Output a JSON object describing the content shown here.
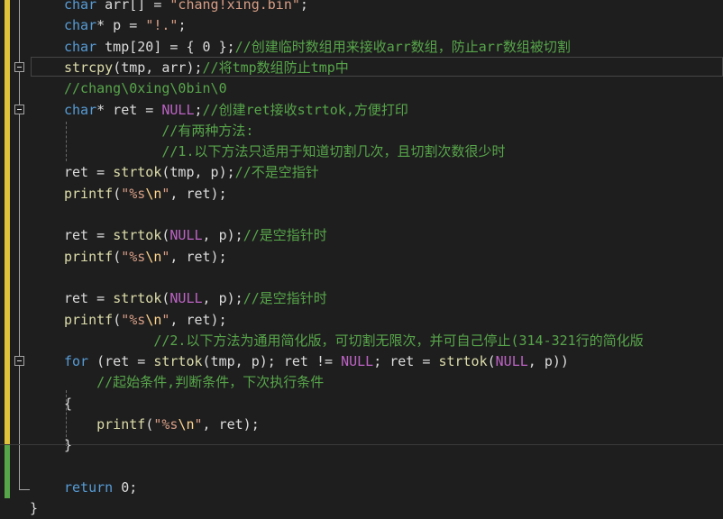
{
  "editor": {
    "lines": [
      {
        "fold": false,
        "tokens": [
          {
            "t": "char",
            "c": "kw"
          },
          {
            "t": " arr[] = ",
            "c": "id"
          },
          {
            "t": "\"chang!xing.bin\"",
            "c": "str"
          },
          {
            "t": ";",
            "c": "id"
          }
        ]
      },
      {
        "fold": false,
        "tokens": [
          {
            "t": "char",
            "c": "kw"
          },
          {
            "t": "* p = ",
            "c": "id"
          },
          {
            "t": "\"!.\"",
            "c": "str"
          },
          {
            "t": ";",
            "c": "id"
          }
        ]
      },
      {
        "fold": false,
        "tokens": [
          {
            "t": "char",
            "c": "kw"
          },
          {
            "t": " tmp[20] = { 0 };",
            "c": "id"
          },
          {
            "t": "//创建临时数组用来接收arr数组，防止arr数组被切割",
            "c": "cmt"
          }
        ]
      },
      {
        "fold": true,
        "tokens": [
          {
            "t": "strcpy",
            "c": "fn"
          },
          {
            "t": "(tmp, arr);",
            "c": "id"
          },
          {
            "t": "//将tmp数组防止tmp中",
            "c": "cmt"
          }
        ]
      },
      {
        "fold": false,
        "tokens": [
          {
            "t": "//chang\\0xing\\0bin\\0",
            "c": "cmt"
          }
        ]
      },
      {
        "fold": true,
        "tokens": [
          {
            "t": "char",
            "c": "kw"
          },
          {
            "t": "* ret = ",
            "c": "id"
          },
          {
            "t": "NULL",
            "c": "macro"
          },
          {
            "t": ";",
            "c": "id"
          },
          {
            "t": "//创建ret接收strtok,方便打印",
            "c": "cmt"
          }
        ]
      },
      {
        "fold": false,
        "tokens": [
          {
            "t": "            ",
            "c": "id"
          },
          {
            "t": "//有两种方法:",
            "c": "cmt"
          }
        ]
      },
      {
        "fold": false,
        "tokens": [
          {
            "t": "            ",
            "c": "id"
          },
          {
            "t": "//1.以下方法只适用于知道切割几次，且切割次数很少时",
            "c": "cmt"
          }
        ]
      },
      {
        "fold": false,
        "tokens": [
          {
            "t": "ret = ",
            "c": "id"
          },
          {
            "t": "strtok",
            "c": "fn"
          },
          {
            "t": "(tmp, p);",
            "c": "id"
          },
          {
            "t": "//不是空指针",
            "c": "cmt"
          }
        ]
      },
      {
        "fold": false,
        "tokens": [
          {
            "t": "printf",
            "c": "fn"
          },
          {
            "t": "(",
            "c": "id"
          },
          {
            "t": "\"%s",
            "c": "str"
          },
          {
            "t": "\\n",
            "c": "esc"
          },
          {
            "t": "\"",
            "c": "str"
          },
          {
            "t": ", ret);",
            "c": "id"
          }
        ]
      },
      {
        "fold": false,
        "tokens": []
      },
      {
        "fold": false,
        "tokens": [
          {
            "t": "ret = ",
            "c": "id"
          },
          {
            "t": "strtok",
            "c": "fn"
          },
          {
            "t": "(",
            "c": "id"
          },
          {
            "t": "NULL",
            "c": "macro"
          },
          {
            "t": ", p);",
            "c": "id"
          },
          {
            "t": "//是空指针时",
            "c": "cmt"
          }
        ]
      },
      {
        "fold": false,
        "tokens": [
          {
            "t": "printf",
            "c": "fn"
          },
          {
            "t": "(",
            "c": "id"
          },
          {
            "t": "\"%s",
            "c": "str"
          },
          {
            "t": "\\n",
            "c": "esc"
          },
          {
            "t": "\"",
            "c": "str"
          },
          {
            "t": ", ret);",
            "c": "id"
          }
        ]
      },
      {
        "fold": false,
        "tokens": []
      },
      {
        "fold": false,
        "tokens": [
          {
            "t": "ret = ",
            "c": "id"
          },
          {
            "t": "strtok",
            "c": "fn"
          },
          {
            "t": "(",
            "c": "id"
          },
          {
            "t": "NULL",
            "c": "macro"
          },
          {
            "t": ", p);",
            "c": "id"
          },
          {
            "t": "//是空指针时",
            "c": "cmt"
          }
        ]
      },
      {
        "fold": false,
        "tokens": [
          {
            "t": "printf",
            "c": "fn"
          },
          {
            "t": "(",
            "c": "id"
          },
          {
            "t": "\"%s",
            "c": "str"
          },
          {
            "t": "\\n",
            "c": "esc"
          },
          {
            "t": "\"",
            "c": "str"
          },
          {
            "t": ", ret);",
            "c": "id"
          }
        ]
      },
      {
        "fold": false,
        "tokens": [
          {
            "t": "           ",
            "c": "id"
          },
          {
            "t": "//2.以下方法为通用简化版，可切割无限次，并可自己停止(314-321行的简化版",
            "c": "cmt"
          }
        ]
      },
      {
        "fold": true,
        "tokens": [
          {
            "t": "for",
            "c": "kw"
          },
          {
            "t": " (ret = ",
            "c": "id"
          },
          {
            "t": "strtok",
            "c": "fn"
          },
          {
            "t": "(tmp, p); ret != ",
            "c": "id"
          },
          {
            "t": "NULL",
            "c": "macro"
          },
          {
            "t": "; ret = ",
            "c": "id"
          },
          {
            "t": "strtok",
            "c": "fn"
          },
          {
            "t": "(",
            "c": "id"
          },
          {
            "t": "NULL",
            "c": "macro"
          },
          {
            "t": ", p))",
            "c": "id"
          }
        ]
      },
      {
        "fold": false,
        "tokens": [
          {
            "t": "    ",
            "c": "id"
          },
          {
            "t": "//起始条件,判断条件，下次执行条件",
            "c": "cmt"
          }
        ]
      },
      {
        "fold": false,
        "tokens": [
          {
            "t": "{",
            "c": "id"
          }
        ]
      },
      {
        "fold": false,
        "tokens": [
          {
            "t": "    ",
            "c": "id"
          },
          {
            "t": "printf",
            "c": "fn"
          },
          {
            "t": "(",
            "c": "id"
          },
          {
            "t": "\"%s",
            "c": "str"
          },
          {
            "t": "\\n",
            "c": "esc"
          },
          {
            "t": "\"",
            "c": "str"
          },
          {
            "t": ", ret);",
            "c": "id"
          }
        ]
      },
      {
        "fold": false,
        "tokens": [
          {
            "t": "}",
            "c": "id"
          }
        ]
      },
      {
        "fold": false,
        "tokens": []
      },
      {
        "fold": false,
        "tokens": [
          {
            "t": "return",
            "c": "kw"
          },
          {
            "t": " 0;",
            "c": "id"
          }
        ]
      },
      {
        "fold": false,
        "tokens": [
          {
            "t": "}",
            "c": "id"
          }
        ]
      }
    ]
  }
}
